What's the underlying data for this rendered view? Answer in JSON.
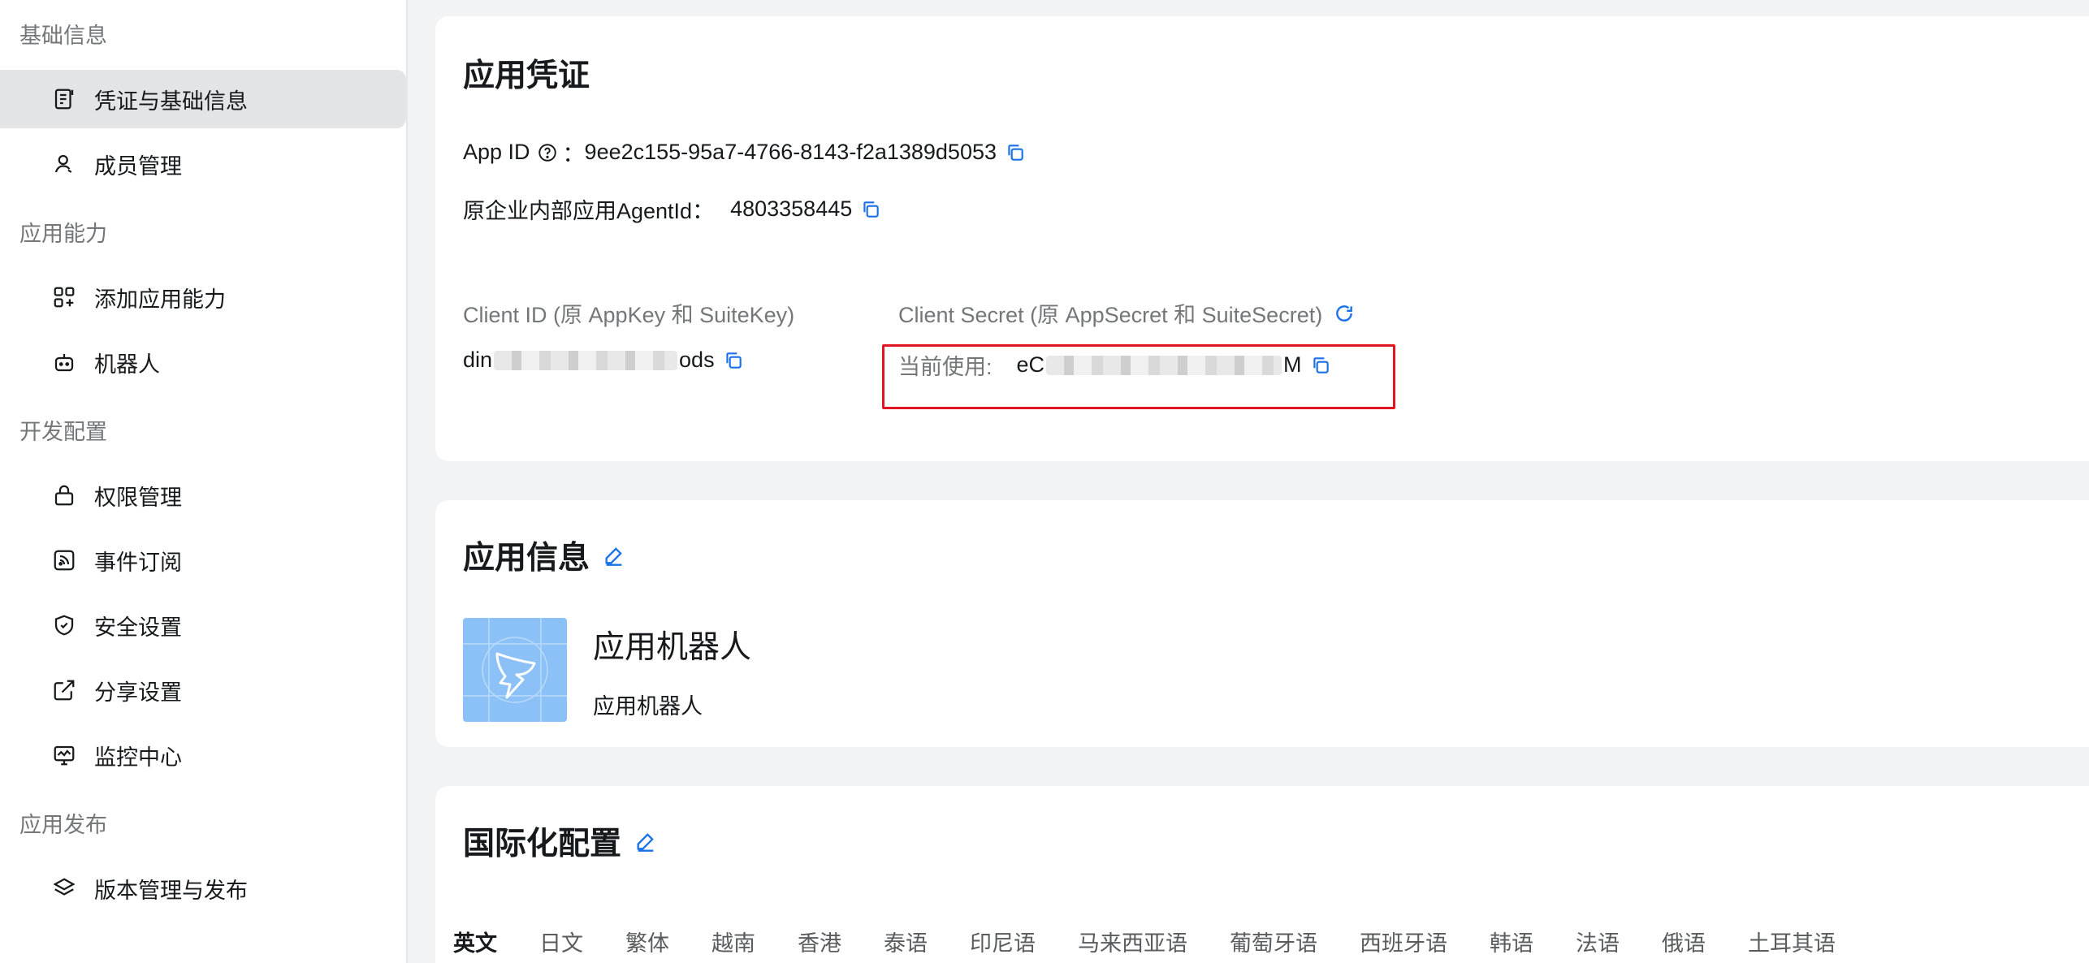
{
  "sidebar": {
    "sections": [
      {
        "title": "基础信息",
        "items": [
          {
            "label": "凭证与基础信息",
            "icon": "credential-icon",
            "active": true
          },
          {
            "label": "成员管理",
            "icon": "user-icon"
          }
        ]
      },
      {
        "title": "应用能力",
        "items": [
          {
            "label": "添加应用能力",
            "icon": "add-capability-icon"
          },
          {
            "label": "机器人",
            "icon": "robot-icon"
          }
        ]
      },
      {
        "title": "开发配置",
        "items": [
          {
            "label": "权限管理",
            "icon": "lock-icon"
          },
          {
            "label": "事件订阅",
            "icon": "rss-icon"
          },
          {
            "label": "安全设置",
            "icon": "shield-icon"
          },
          {
            "label": "分享设置",
            "icon": "share-icon"
          },
          {
            "label": "监控中心",
            "icon": "monitor-icon"
          }
        ]
      },
      {
        "title": "应用发布",
        "items": [
          {
            "label": "版本管理与发布",
            "icon": "layers-icon"
          }
        ]
      }
    ]
  },
  "credentials": {
    "title": "应用凭证",
    "app_id_label": "App ID",
    "app_id_colon": "：",
    "app_id_value": "9ee2c155-95a7-4766-8143-f2a1389d5053",
    "agent_id_label": "原企业内部应用AgentId：",
    "agent_id_value": "4803358445",
    "client_id_label": "Client ID (原 AppKey 和 SuiteKey)",
    "client_id_prefix": "din",
    "client_id_suffix": "ods",
    "client_secret_label": "Client Secret (原 AppSecret 和 SuiteSecret)",
    "current_use_label": "当前使用:",
    "client_secret_prefix": "eC",
    "client_secret_suffix": "M"
  },
  "app_info": {
    "title": "应用信息",
    "app_name": "应用机器人",
    "app_desc": "应用机器人"
  },
  "i18n": {
    "title": "国际化配置",
    "tabs": [
      "英文",
      "日文",
      "繁体",
      "越南",
      "香港",
      "泰语",
      "印尼语",
      "马来西亚语",
      "葡萄牙语",
      "西班牙语",
      "韩语",
      "法语",
      "俄语",
      "土耳其语"
    ],
    "active_tab": 0
  },
  "colors": {
    "accent": "#1a72e8",
    "highlight_border": "#e0151f",
    "logo_bg": "#8cc1f7"
  }
}
